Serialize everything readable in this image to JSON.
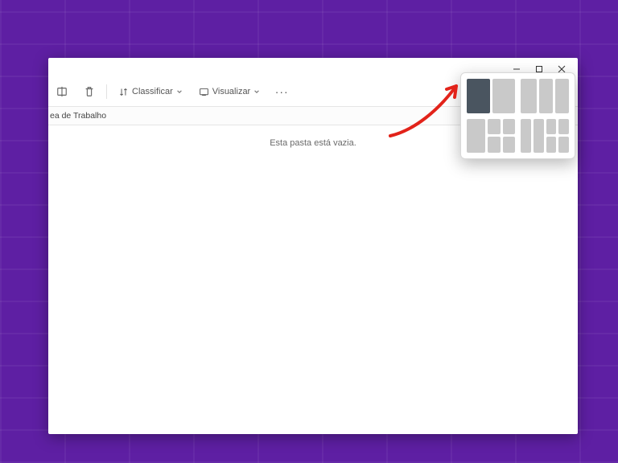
{
  "toolbar": {
    "sort_label": "Classificar",
    "view_label": "Visualizar"
  },
  "breadcrumb": {
    "current": "ea de Trabalho"
  },
  "content": {
    "empty": "Esta pasta está vazia."
  },
  "colors": {
    "accent_bg": "#5e1fa3",
    "snap_active": "#4a5560",
    "annotation_red": "#e2231a"
  }
}
